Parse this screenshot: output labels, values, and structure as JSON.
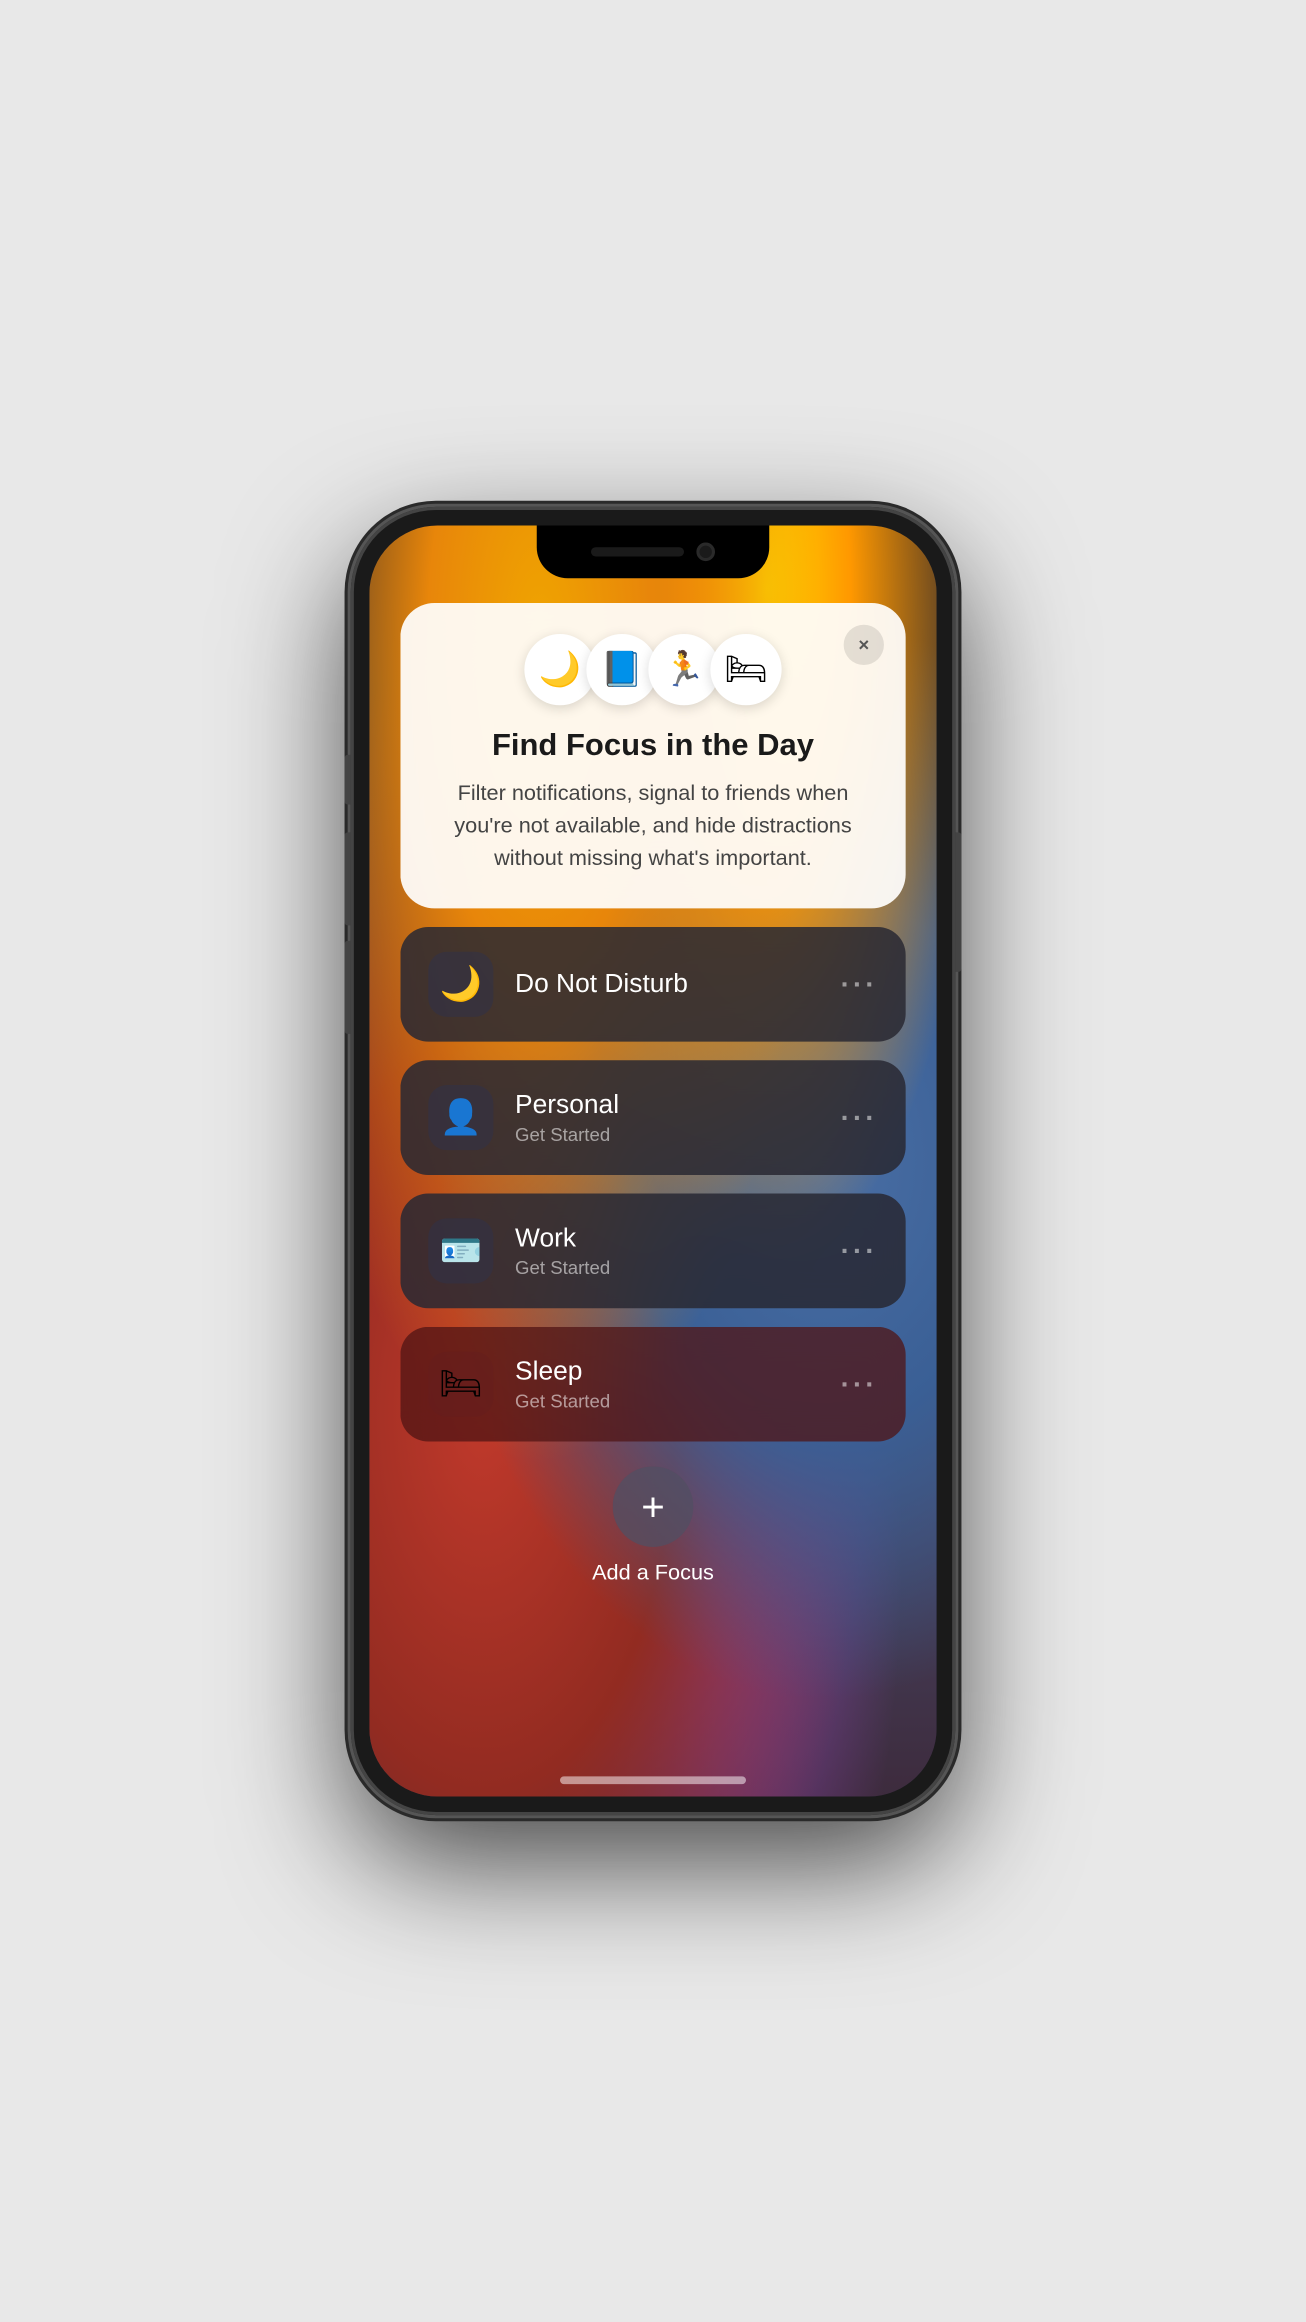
{
  "phone": {
    "notch": {
      "aria": "notch"
    }
  },
  "focusCard": {
    "icons": [
      "🌙",
      "📘",
      "🏃",
      "🛏"
    ],
    "title": "Find Focus in the Day",
    "description": "Filter notifications, signal to friends when you're not available, and hide distractions without missing what's important.",
    "closeLabel": "×"
  },
  "focusItems": [
    {
      "id": "do-not-disturb",
      "name": "Do Not Disturb",
      "sub": "",
      "icon": "🌙",
      "iconBg": "rgba(50,50,70,0.8)"
    },
    {
      "id": "personal",
      "name": "Personal",
      "sub": "Get Started",
      "icon": "👤",
      "iconBg": "rgba(50,50,70,0.8)"
    },
    {
      "id": "work",
      "name": "Work",
      "sub": "Get Started",
      "icon": "🪪",
      "iconBg": "rgba(50,50,70,0.8)"
    },
    {
      "id": "sleep",
      "name": "Sleep",
      "sub": "Get Started",
      "icon": "🛏",
      "iconBg": "rgba(80,20,20,0.5)"
    }
  ],
  "addFocus": {
    "label": "Add a Focus",
    "icon": "+"
  }
}
